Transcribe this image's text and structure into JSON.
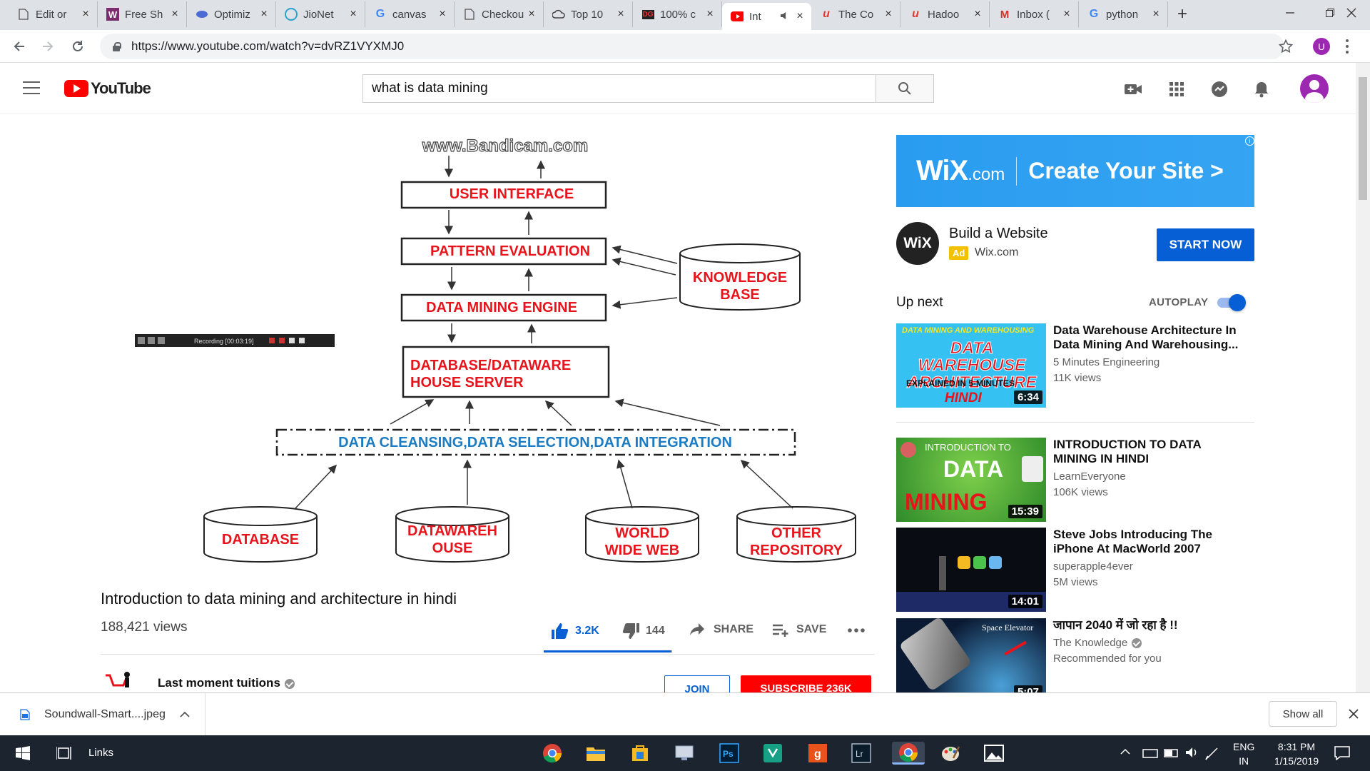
{
  "browser": {
    "tabs": [
      {
        "label": "Edit or",
        "icon": "doc-icon"
      },
      {
        "label": "Free Sh",
        "icon": "w-icon"
      },
      {
        "label": "Optimiz",
        "icon": "eye-icon"
      },
      {
        "label": "JioNet",
        "icon": "jio-icon"
      },
      {
        "label": "canvas",
        "icon": "google-icon"
      },
      {
        "label": "Checkou",
        "icon": "doc-icon"
      },
      {
        "label": "Top 10",
        "icon": "cloud-icon"
      },
      {
        "label": "100% c",
        "icon": "dg-icon"
      },
      {
        "label": "Int",
        "icon": "youtube-icon",
        "active": true
      },
      {
        "label": "The Co",
        "icon": "u-icon"
      },
      {
        "label": "Hadoo",
        "icon": "u-icon"
      },
      {
        "label": "Inbox (",
        "icon": "gmail-icon"
      },
      {
        "label": "python",
        "icon": "google-icon"
      }
    ],
    "url": "https://www.youtube.com/watch?v=dvRZ1VYXMJ0",
    "profile_initial": "U"
  },
  "youtube": {
    "logo_text": "YouTube",
    "search_value": "what is data mining"
  },
  "video": {
    "watermark": "www.Bandicam.com",
    "recording_label": "Recording [00:03:19]",
    "diagram": {
      "user_interface": "USER INTERFACE",
      "pattern_eval": "PATTERN EVALUATION",
      "engine": "DATA MINING ENGINE",
      "kb_line1": "KNOWLEDGE",
      "kb_line2": "BASE",
      "server_line1": "DATABASE/DATAWARE",
      "server_line2": "HOUSE SERVER",
      "cleansing": "DATA CLEANSING,DATA SELECTION,DATA INTEGRATION",
      "src1": "DATABASE",
      "src2_line1": "DATAWAREH",
      "src2_line2": "OUSE",
      "src3_line1": "WORLD",
      "src3_line2": "WIDE WEB",
      "src4_line1": "OTHER",
      "src4_line2": "REPOSITORY"
    },
    "title": "Introduction to data mining and architecture in hindi",
    "views": "188,421 views",
    "likes": "3.2K",
    "dislikes": "144",
    "share": "SHARE",
    "save": "SAVE",
    "channel": "Last moment tuitions",
    "join": "JOIN",
    "subscribe": "SUBSCRIBE 236K"
  },
  "ad": {
    "banner_brand": "WiX",
    "banner_brand_suffix": ".com",
    "banner_cta": "Create Your Site >",
    "logo_text": "WiX",
    "title": "Build a Website",
    "badge": "Ad",
    "domain": "Wix.com",
    "button": "START NOW"
  },
  "sidebar": {
    "up_next": "Up next",
    "autoplay": "AUTOPLAY",
    "items": [
      {
        "title": "Data Warehouse Architecture In Data Mining And Warehousing...",
        "channel": "5 Minutes Engineering",
        "meta": "11K views",
        "duration": "6:34",
        "thumb_top": "DATA MINING AND WAREHOUSING",
        "thumb_main": "DATA WAREHOUSE ARCHITECTURE",
        "thumb_sub": "EXPLAINED IN 5-MINUTES",
        "thumb_lang": "HINDI"
      },
      {
        "title": "INTRODUCTION TO DATA MINING IN HINDI",
        "channel": "LearnEveryone",
        "meta": "106K views",
        "duration": "15:39",
        "thumb_top": "INTRODUCTION TO",
        "thumb_main": "DATA",
        "thumb_sub": "MINING"
      },
      {
        "title": "Steve Jobs Introducing The iPhone At MacWorld 2007",
        "channel": "superapple4ever",
        "meta": "5M views",
        "duration": "14:01"
      },
      {
        "title": "जापान 2040 में जो रहा है !!",
        "channel": "The Knowledge",
        "meta": "Recommended for you",
        "duration": "5:07",
        "thumb_top": "Space Elevator"
      }
    ]
  },
  "download": {
    "file": "Soundwall-Smart....jpeg",
    "show_all": "Show all"
  },
  "taskbar": {
    "links": "Links",
    "lang1": "ENG",
    "lang2": "IN",
    "time": "8:31 PM",
    "date": "1/15/2019"
  },
  "colors": {
    "youtube_red": "#ff0000",
    "blue": "#065fd4",
    "diagram_red": "#e8141c",
    "diagram_blue": "#1b7cc4"
  }
}
